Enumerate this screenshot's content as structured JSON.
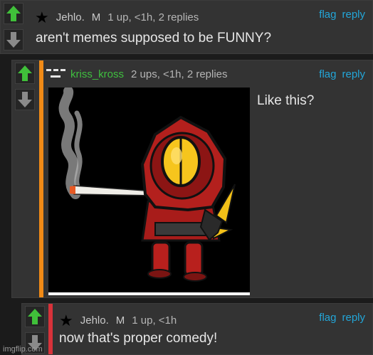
{
  "comments": [
    {
      "username": "Jehlo.",
      "mod_tag": "M",
      "meta": "1 up, <1h, 2 replies",
      "text": "aren't memes supposed to be FUNNY?",
      "actions": [
        "flag",
        "reply"
      ]
    },
    {
      "username": "kriss_kross",
      "meta": "2 ups, <1h, 2 replies",
      "text": "Like this?",
      "actions": [
        "flag",
        "reply"
      ],
      "image": {
        "subject": "red hooded robot character smoking a cigarette"
      }
    },
    {
      "username": "Jehlo.",
      "mod_tag": "M",
      "meta": "1 up, <1h",
      "text": "now that's proper comedy!",
      "actions": [
        "flag",
        "reply"
      ]
    }
  ],
  "watermark": "imgflip.com",
  "colors": {
    "background": "#1b1b1b",
    "panel": "#333333",
    "upvote": "#40c03a",
    "link": "#23a6d8",
    "reply_bar_orange": "#f08a16",
    "reply_bar_red": "#d8323a",
    "username_green": "#3fbf3f"
  },
  "icons": {
    "upvote": "up-arrow-icon",
    "downvote": "down-arrow-icon",
    "star": "star-icon",
    "flair": "flair-icon"
  }
}
